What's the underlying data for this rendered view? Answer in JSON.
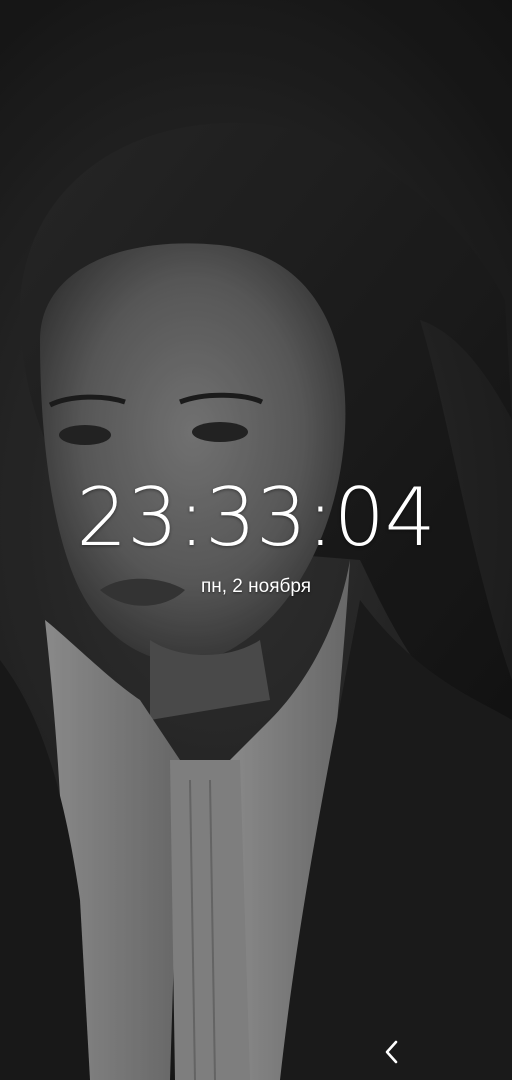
{
  "lockscreen": {
    "time": "23:33:04",
    "date": "пн, 2 ноября"
  },
  "wallpaper": {
    "description_icon": "portrait-photo"
  },
  "navigation": {
    "back_icon": "chevron-left-icon"
  },
  "colors": {
    "text": "#ffffff",
    "background": "#1b1b1b"
  }
}
